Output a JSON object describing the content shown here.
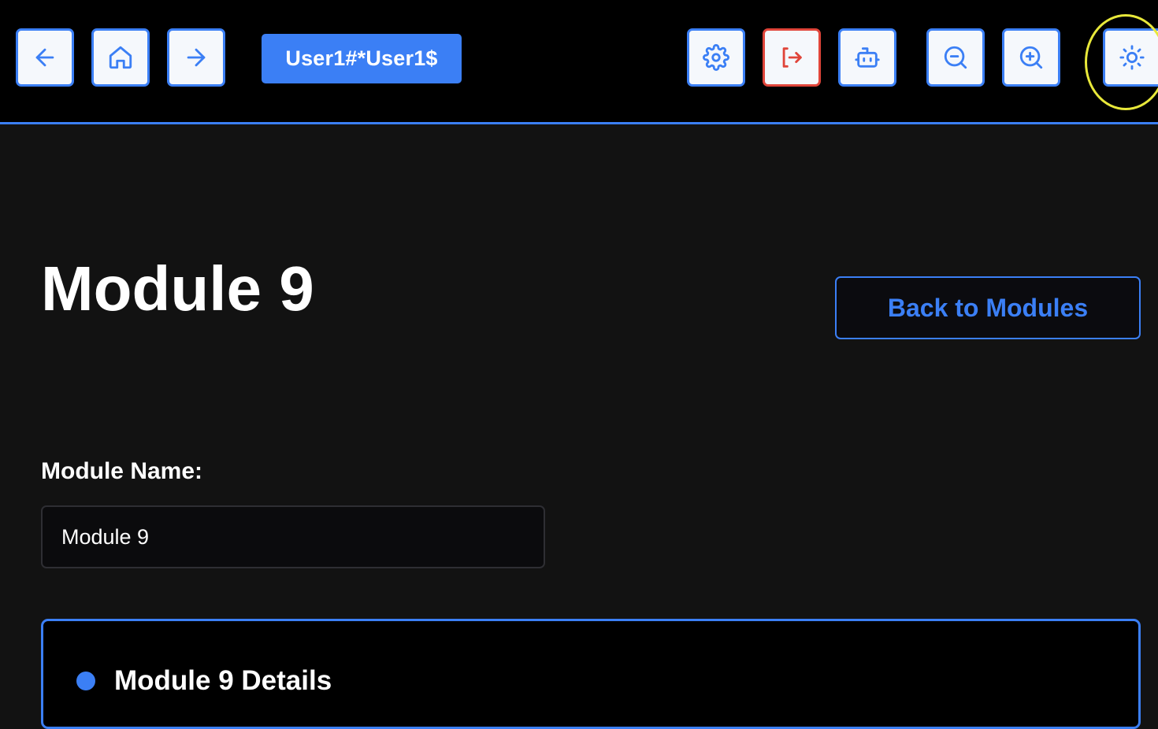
{
  "toolbar": {
    "user_label": "User1#*User1$",
    "icons": {
      "back": "arrow-left-icon",
      "home": "home-icon",
      "forward": "arrow-right-icon",
      "settings": "gear-icon",
      "logout": "logout-icon",
      "assistant": "robot-icon",
      "zoom_out": "zoom-out-icon",
      "zoom_in": "zoom-in-icon",
      "theme": "sun-icon"
    }
  },
  "main": {
    "title": "Module 9",
    "back_button_label": "Back to Modules",
    "module_name_label": "Module Name:",
    "module_name_value": "Module 9",
    "details_title": "Module 9 Details"
  },
  "colors": {
    "accent": "#3b7ff5",
    "danger": "#e0453a",
    "highlight": "#e8e83a",
    "background": "#121212",
    "topbar": "#000000"
  }
}
